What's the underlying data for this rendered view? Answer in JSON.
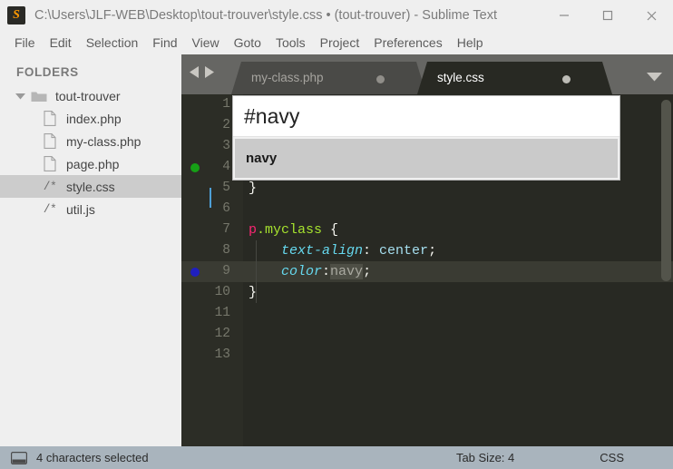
{
  "window": {
    "logo_letter": "S",
    "title": "C:\\Users\\JLF-WEB\\Desktop\\tout-trouver\\style.css • (tout-trouver) - Sublime Text",
    "minimize_label": "Minimize",
    "maximize_label": "Maximize",
    "close_label": "Close"
  },
  "menubar": {
    "items": [
      {
        "label": "File"
      },
      {
        "label": "Edit"
      },
      {
        "label": "Selection"
      },
      {
        "label": "Find"
      },
      {
        "label": "View"
      },
      {
        "label": "Goto"
      },
      {
        "label": "Tools"
      },
      {
        "label": "Project"
      },
      {
        "label": "Preferences"
      },
      {
        "label": "Help"
      }
    ]
  },
  "sidebar": {
    "header": "FOLDERS",
    "folder": {
      "label": "tout-trouver",
      "expanded": true
    },
    "files": [
      {
        "label": "index.php",
        "icon": "page",
        "selected": false
      },
      {
        "label": "my-class.php",
        "icon": "page",
        "selected": false
      },
      {
        "label": "page.php",
        "icon": "page",
        "selected": false
      },
      {
        "label": "style.css",
        "icon": "comment",
        "icon_text": "/*",
        "selected": true
      },
      {
        "label": "util.js",
        "icon": "comment",
        "icon_text": "/*",
        "selected": false
      }
    ]
  },
  "tabs": {
    "items": [
      {
        "label": "my-class.php",
        "active": false,
        "dirty": true
      },
      {
        "label": "style.css",
        "active": true,
        "dirty": true
      }
    ]
  },
  "editor": {
    "language": "CSS",
    "lines": [
      {
        "number": "1",
        "marker": null,
        "current": false,
        "tokens": []
      },
      {
        "number": "2",
        "marker": null,
        "current": false,
        "tokens": []
      },
      {
        "number": "3",
        "marker": null,
        "current": false,
        "tokens": []
      },
      {
        "number": "4",
        "marker": "green",
        "current": false,
        "tokens": []
      },
      {
        "number": "5",
        "marker": null,
        "current": false,
        "tokens": [
          {
            "text": "}",
            "cls": "tok-brace"
          }
        ]
      },
      {
        "number": "6",
        "marker": null,
        "current": false,
        "tokens": []
      },
      {
        "number": "7",
        "marker": null,
        "current": false,
        "tokens": [
          {
            "text": "p",
            "cls": "tok-sel"
          },
          {
            "text": ".myclass",
            "cls": "tok-class"
          },
          {
            "text": " {",
            "cls": "tok-brace"
          }
        ]
      },
      {
        "number": "8",
        "marker": null,
        "current": false,
        "tokens": [
          {
            "text": "    ",
            "cls": "tok-punc"
          },
          {
            "text": "text-align",
            "cls": "tok-prop"
          },
          {
            "text": ": ",
            "cls": "tok-punc"
          },
          {
            "text": "center",
            "cls": "tok-val"
          },
          {
            "text": ";",
            "cls": "tok-punc"
          }
        ]
      },
      {
        "number": "9",
        "marker": "blue",
        "current": true,
        "tokens": [
          {
            "text": "    ",
            "cls": "tok-punc"
          },
          {
            "text": "color",
            "cls": "tok-prop"
          },
          {
            "text": ":",
            "cls": "tok-punc"
          },
          {
            "text": "navy",
            "cls": "tok-sel-hl"
          },
          {
            "text": ";",
            "cls": "tok-punc"
          }
        ]
      },
      {
        "number": "10",
        "marker": null,
        "current": false,
        "tokens": [
          {
            "text": "}",
            "cls": "tok-brace"
          }
        ]
      },
      {
        "number": "11",
        "marker": null,
        "current": false,
        "tokens": []
      },
      {
        "number": "12",
        "marker": null,
        "current": false,
        "tokens": []
      },
      {
        "number": "13",
        "marker": null,
        "current": false,
        "tokens": []
      }
    ]
  },
  "autocomplete": {
    "input_value": "#navy",
    "items": [
      {
        "label": "navy",
        "selected": true
      }
    ]
  },
  "statusbar": {
    "selection_text": "4 characters selected",
    "tab_size": "Tab Size: 4",
    "syntax": "CSS"
  },
  "colors": {
    "editor_bg": "#282923",
    "gutter_bg": "#2c2d26",
    "tabbar_bg": "#666663",
    "active_tab_bg": "#282923",
    "inactive_tab_bg": "#4a4a47",
    "sidebar_bg": "#efefef",
    "statusbar_bg": "#a9b4bd",
    "accent_orange": "#ff9800",
    "marker_green": "#16a016",
    "marker_blue": "#1f1fbf"
  }
}
